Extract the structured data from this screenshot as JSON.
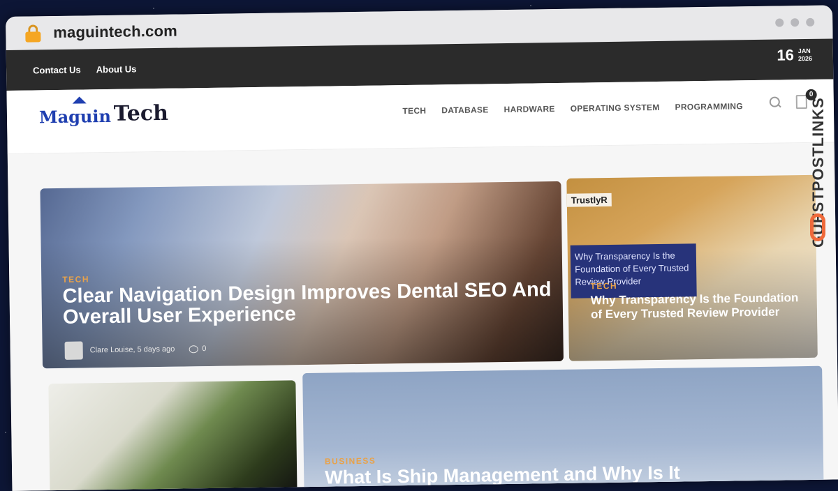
{
  "browser": {
    "url": "maguintech.com"
  },
  "topbar": {
    "links": [
      "Contact Us",
      "About Us"
    ],
    "date_day": "16",
    "date_month": "JAN",
    "date_year": "2026"
  },
  "logo": {
    "part1": "Maguin",
    "part2": "Tech"
  },
  "nav": [
    "TECH",
    "DATABASE",
    "HARDWARE",
    "OPERATING SYSTEM",
    "PROGRAMMING"
  ],
  "cart": {
    "count": "0"
  },
  "hero": {
    "category": "TECH",
    "title": "Clear Navigation Design Improves Dental SEO And Overall User Experience",
    "author_date": "Clare Louise, 5 days ago",
    "comments": "0"
  },
  "side_post": {
    "brand": "TrustlyR",
    "image_caption": "Why Transparency Is the Foundation of Every Trusted Review Provider",
    "category": "TECH",
    "title": "Why Transparency Is the Foundation of Every Trusted Review Provider"
  },
  "post3": {
    "category": "BUSINESS",
    "title": "What Is Ship Management and Why Is It"
  },
  "banner": {
    "text": "GUESTPOSTLINKS"
  }
}
